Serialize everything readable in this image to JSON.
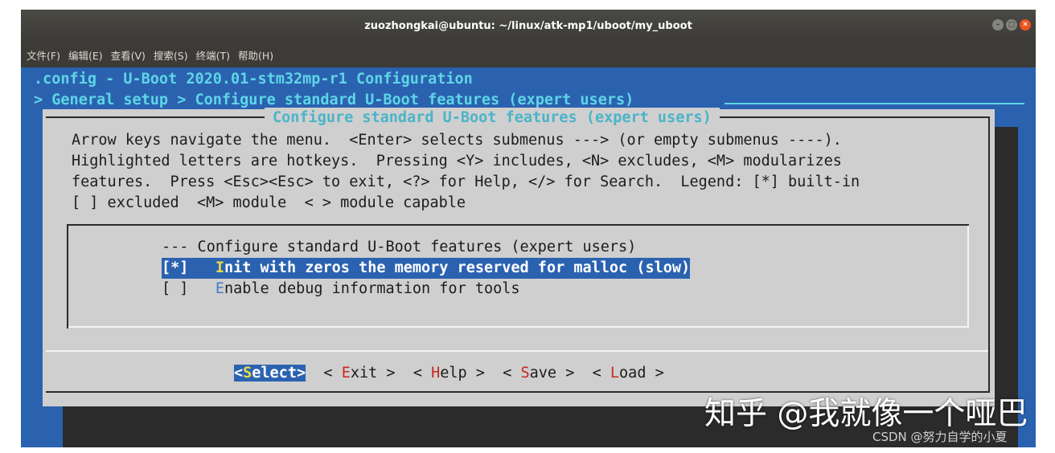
{
  "window": {
    "title": "zuozhongkai@ubuntu: ~/linux/atk-mp1/uboot/my_uboot",
    "controls": [
      "minimize-icon",
      "maximize-icon",
      "close-icon"
    ]
  },
  "menubar": {
    "items": [
      "文件(F)",
      "编辑(E)",
      "查看(V)",
      "搜索(S)",
      "终端(T)",
      "帮助(H)"
    ]
  },
  "terminal": {
    "header_line1": ".config - U-Boot 2020.01-stm32mp-r1 Configuration",
    "header_line2": "> General setup > Configure standard U-Boot features (expert users)",
    "dialog": {
      "title": "Configure standard U-Boot features (expert users)",
      "help_text": "Arrow keys navigate the menu.  <Enter> selects submenus ---> (or empty submenus ----).\nHighlighted letters are hotkeys.  Pressing <Y> includes, <N> excludes, <M> modularizes\nfeatures.  Press <Esc><Esc> to exit, <?> for Help, </> for Search.  Legend: [*] built-in\n[ ] excluded  <M> module  < > module capable",
      "menu": {
        "heading": "--- Configure standard U-Boot features (expert users)",
        "items": [
          {
            "mark": "[*]",
            "hotkey": "I",
            "rest": "nit with zeros the memory reserved for malloc (slow)",
            "selected": true
          },
          {
            "mark": "[ ]",
            "hotkey": "E",
            "rest": "nable debug information for tools",
            "selected": false
          }
        ]
      },
      "buttons": [
        {
          "left": "<",
          "hotkey": "S",
          "rest": "elect",
          "right": ">",
          "selected": true
        },
        {
          "left": "< ",
          "hotkey": "E",
          "rest": "xit",
          "right": " >",
          "selected": false
        },
        {
          "left": "< ",
          "hotkey": "H",
          "rest": "elp",
          "right": " >",
          "selected": false
        },
        {
          "left": "< ",
          "hotkey": "S",
          "rest": "ave",
          "right": " >",
          "selected": false
        },
        {
          "left": "< ",
          "hotkey": "L",
          "rest": "oad",
          "right": " >",
          "selected": false
        }
      ]
    }
  },
  "watermarks": {
    "zhihu": "知乎 @我就像一个哑巴",
    "csdn": "CSDN @努力自学的小夏"
  },
  "colors": {
    "terminal_bg": "#2b62b0",
    "header_text": "#5ed6e6",
    "dialog_bg": "#cfcfcf",
    "hotkey_selected": "#e8d84a",
    "hotkey_button": "#c8281e",
    "ubuntu_close": "#e95420"
  }
}
